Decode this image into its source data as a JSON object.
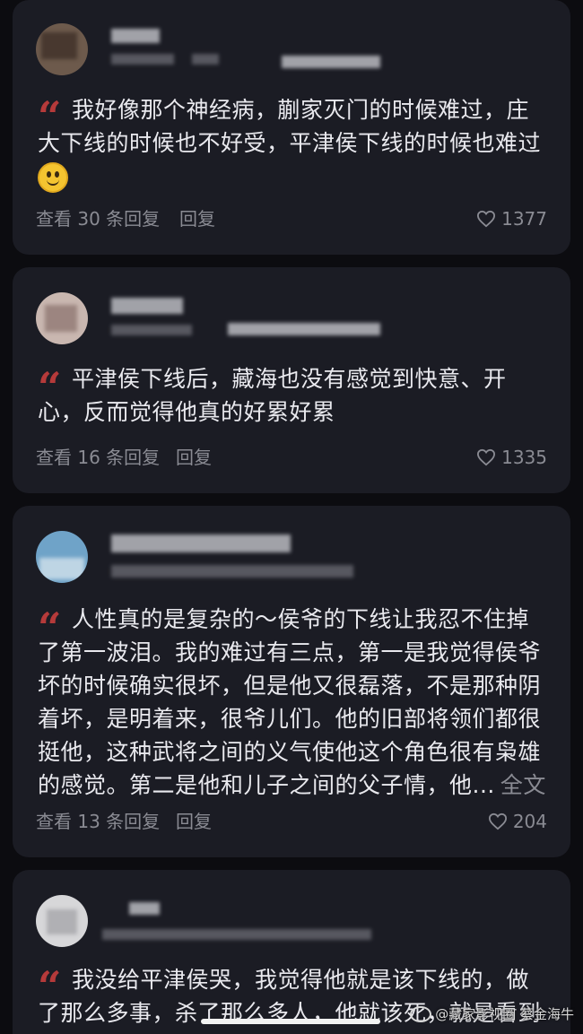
{
  "comments": [
    {
      "text": "我好像那个神经病，蒯家灭门的时候难过，庄大下线的时候也不好受，平津侯下线的时候也难过",
      "emoji": "smile",
      "view_replies": "查看 30 条回复",
      "reply": "回复",
      "likes": "1377"
    },
    {
      "text": "平津侯下线后，藏海也没有感觉到快意、开心，反而觉得他真的好累好累",
      "view_replies": "查看 16 条回复",
      "reply": "回复",
      "likes": "1335"
    },
    {
      "text": "人性真的是复杂的～侯爷的下线让我忍不住掉了第一波泪。我的难过有三点，第一是我觉得侯爷坏的时候确实很坏，但是他又很磊落，不是那种阴着坏，是明着来，很爷儿们。他的旧部将领们都很挺他，这种武将之间的义气使他这个角色很有枭雄的感觉。第二是他和儿子之间的父子情，他...",
      "expand": "全文",
      "view_replies": "查看 13 条回复",
      "reply": "回复",
      "likes": "204"
    },
    {
      "text": "我没给平津侯哭，我觉得他就是该下线的，做了那么多事，杀了那么多人，他就该死，就是看到"
    }
  ],
  "watermark": "@藏家影视圈 蔡金海牛",
  "colors": {
    "background": "#0c0c10",
    "card": "#1b1c24",
    "quote": "#b53a3a",
    "muted": "#8a8b93"
  }
}
